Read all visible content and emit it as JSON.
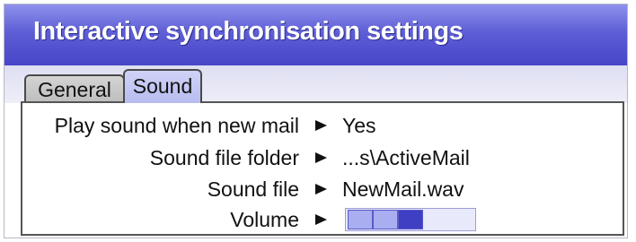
{
  "window": {
    "title": "Interactive synchronisation settings"
  },
  "tabs": [
    {
      "label": "General",
      "selected": false
    },
    {
      "label": "Sound",
      "selected": true
    }
  ],
  "settings": {
    "play_sound": {
      "label": "Play sound when new mail",
      "value": "Yes"
    },
    "sound_folder": {
      "label": "Sound file folder",
      "value": "...s\\ActiveMail"
    },
    "sound_file": {
      "label": "Sound file",
      "value": "NewMail.wav"
    },
    "volume": {
      "label": "Volume",
      "level": 3,
      "max": 6
    }
  },
  "colors": {
    "title_bar": "#5e5ed6",
    "selected_tab": "#c4c8f4",
    "volume_on_dark": "#3f3fc4",
    "volume_on_light": "#a9aef0",
    "volume_off": "#e8e9fb"
  }
}
